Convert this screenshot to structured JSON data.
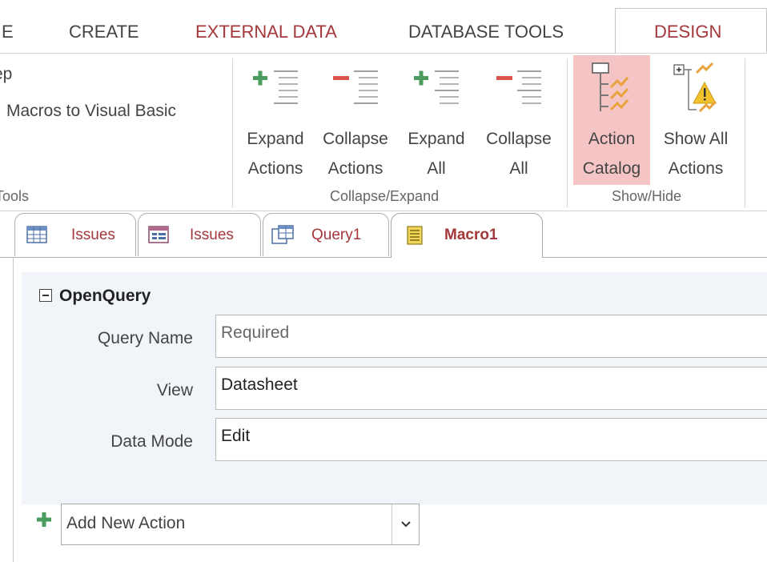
{
  "ribbon_tabs": {
    "partial": "E",
    "create": "CREATE",
    "external_data": "EXTERNAL DATA",
    "database_tools": "DATABASE TOOLS",
    "design": "DESIGN"
  },
  "tools_group": {
    "line1": "ep",
    "line2": "Macros to Visual Basic",
    "label": "Tools"
  },
  "collapse_expand_group": {
    "label": "Collapse/Expand",
    "expand_actions": {
      "line1": "Expand",
      "line2": "Actions"
    },
    "collapse_actions": {
      "line1": "Collapse",
      "line2": "Actions"
    },
    "expand_all": {
      "line1": "Expand",
      "line2": "All"
    },
    "collapse_all": {
      "line1": "Collapse",
      "line2": "All"
    }
  },
  "show_hide_group": {
    "label": "Show/Hide",
    "action_catalog": {
      "line1": "Action",
      "line2": "Catalog"
    },
    "show_all_actions": {
      "line1": "Show All",
      "line2": "Actions"
    }
  },
  "document_tabs": [
    {
      "label": "Issues",
      "icon": "table-icon"
    },
    {
      "label": "Issues",
      "icon": "form-icon"
    },
    {
      "label": "Query1",
      "icon": "query-icon"
    },
    {
      "label": "Macro1",
      "icon": "macro-icon"
    }
  ],
  "macro": {
    "action_name": "OpenQuery",
    "arguments": [
      {
        "label": "Query Name",
        "value": "Required"
      },
      {
        "label": "View",
        "value": "Datasheet"
      },
      {
        "label": "Data Mode",
        "value": "Edit"
      }
    ],
    "add_new_action": "Add New Action"
  },
  "colors": {
    "accent_tab_text": "#a4373a",
    "active_button_bg": "#f5c5c5",
    "action_block_bg": "#f1f4f9",
    "plus_green": "#4a9b5d",
    "minus_red": "#d9534f"
  }
}
